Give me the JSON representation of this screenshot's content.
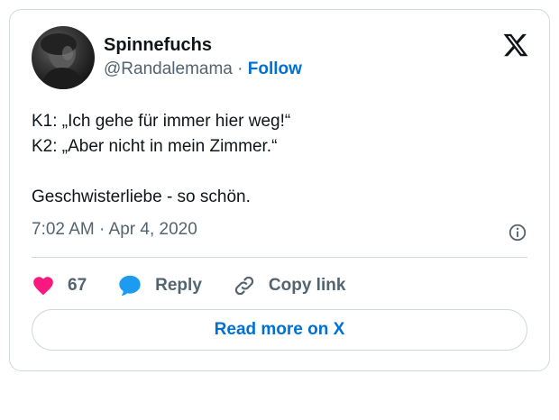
{
  "author": {
    "display_name": "Spinnefuchs",
    "handle": "@Randalemama",
    "separator": "·",
    "follow_label": "Follow"
  },
  "tweet": {
    "lines": [
      "K1: „Ich gehe für immer hier weg!“",
      "K2: „Aber nicht in mein Zimmer.“",
      "",
      "Geschwisterliebe - so schön."
    ],
    "timestamp": "7:02 AM · Apr 4, 2020"
  },
  "actions": {
    "like_count": "67",
    "reply_label": "Reply",
    "copy_link_label": "Copy link"
  },
  "read_more_label": "Read more on X",
  "icons": {
    "logo": "x-logo-icon",
    "info": "info-icon",
    "like": "heart-icon",
    "reply": "speech-bubble-icon",
    "copy": "link-icon"
  },
  "colors": {
    "like": "#f91880",
    "reply": "#1d9bf0",
    "link_blue": "#006fd6",
    "muted": "#536471",
    "border": "#cfd9de"
  }
}
